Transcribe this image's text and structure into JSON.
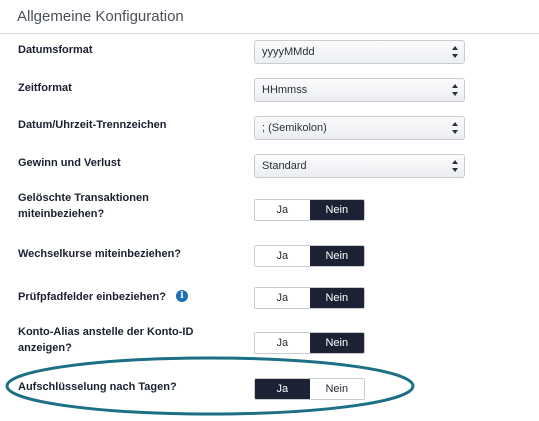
{
  "section": {
    "title": "Allgemeine Konfiguration"
  },
  "fields": {
    "date_format": {
      "label": "Datumsformat",
      "value": "yyyyMMdd"
    },
    "time_format": {
      "label": "Zeitformat",
      "value": "HHmmss"
    },
    "separator": {
      "label": "Datum/Uhrzeit-Trennzeichen",
      "value": "; (Semikolon)"
    },
    "profit_loss": {
      "label": "Gewinn und Verlust",
      "value": "Standard"
    },
    "deleted_transactions": {
      "label_line1": "Gelöschte Transaktionen",
      "label_line2": "miteinbeziehen?",
      "yes": "Ja",
      "no": "Nein",
      "selected": "Nein"
    },
    "exchange_rates": {
      "label": "Wechselkurse miteinbeziehen?",
      "yes": "Ja",
      "no": "Nein",
      "selected": "Nein"
    },
    "audit_trail": {
      "label": "Prüfpfadfelder einbeziehen?",
      "info_glyph": "i",
      "yes": "Ja",
      "no": "Nein",
      "selected": "Nein"
    },
    "account_alias": {
      "label_line1": "Konto-Alias anstelle der Konto-ID",
      "label_line2": "anzeigen?",
      "yes": "Ja",
      "no": "Nein",
      "selected": "Nein"
    },
    "breakdown_by_days": {
      "label": "Aufschlüsselung nach Tagen?",
      "yes": "Ja",
      "no": "Nein",
      "selected": "Ja"
    }
  },
  "colors": {
    "toggle_active_bg": "#1c2233",
    "highlight_ellipse": "#1d6f86",
    "info_icon": "#1f6fb5"
  }
}
